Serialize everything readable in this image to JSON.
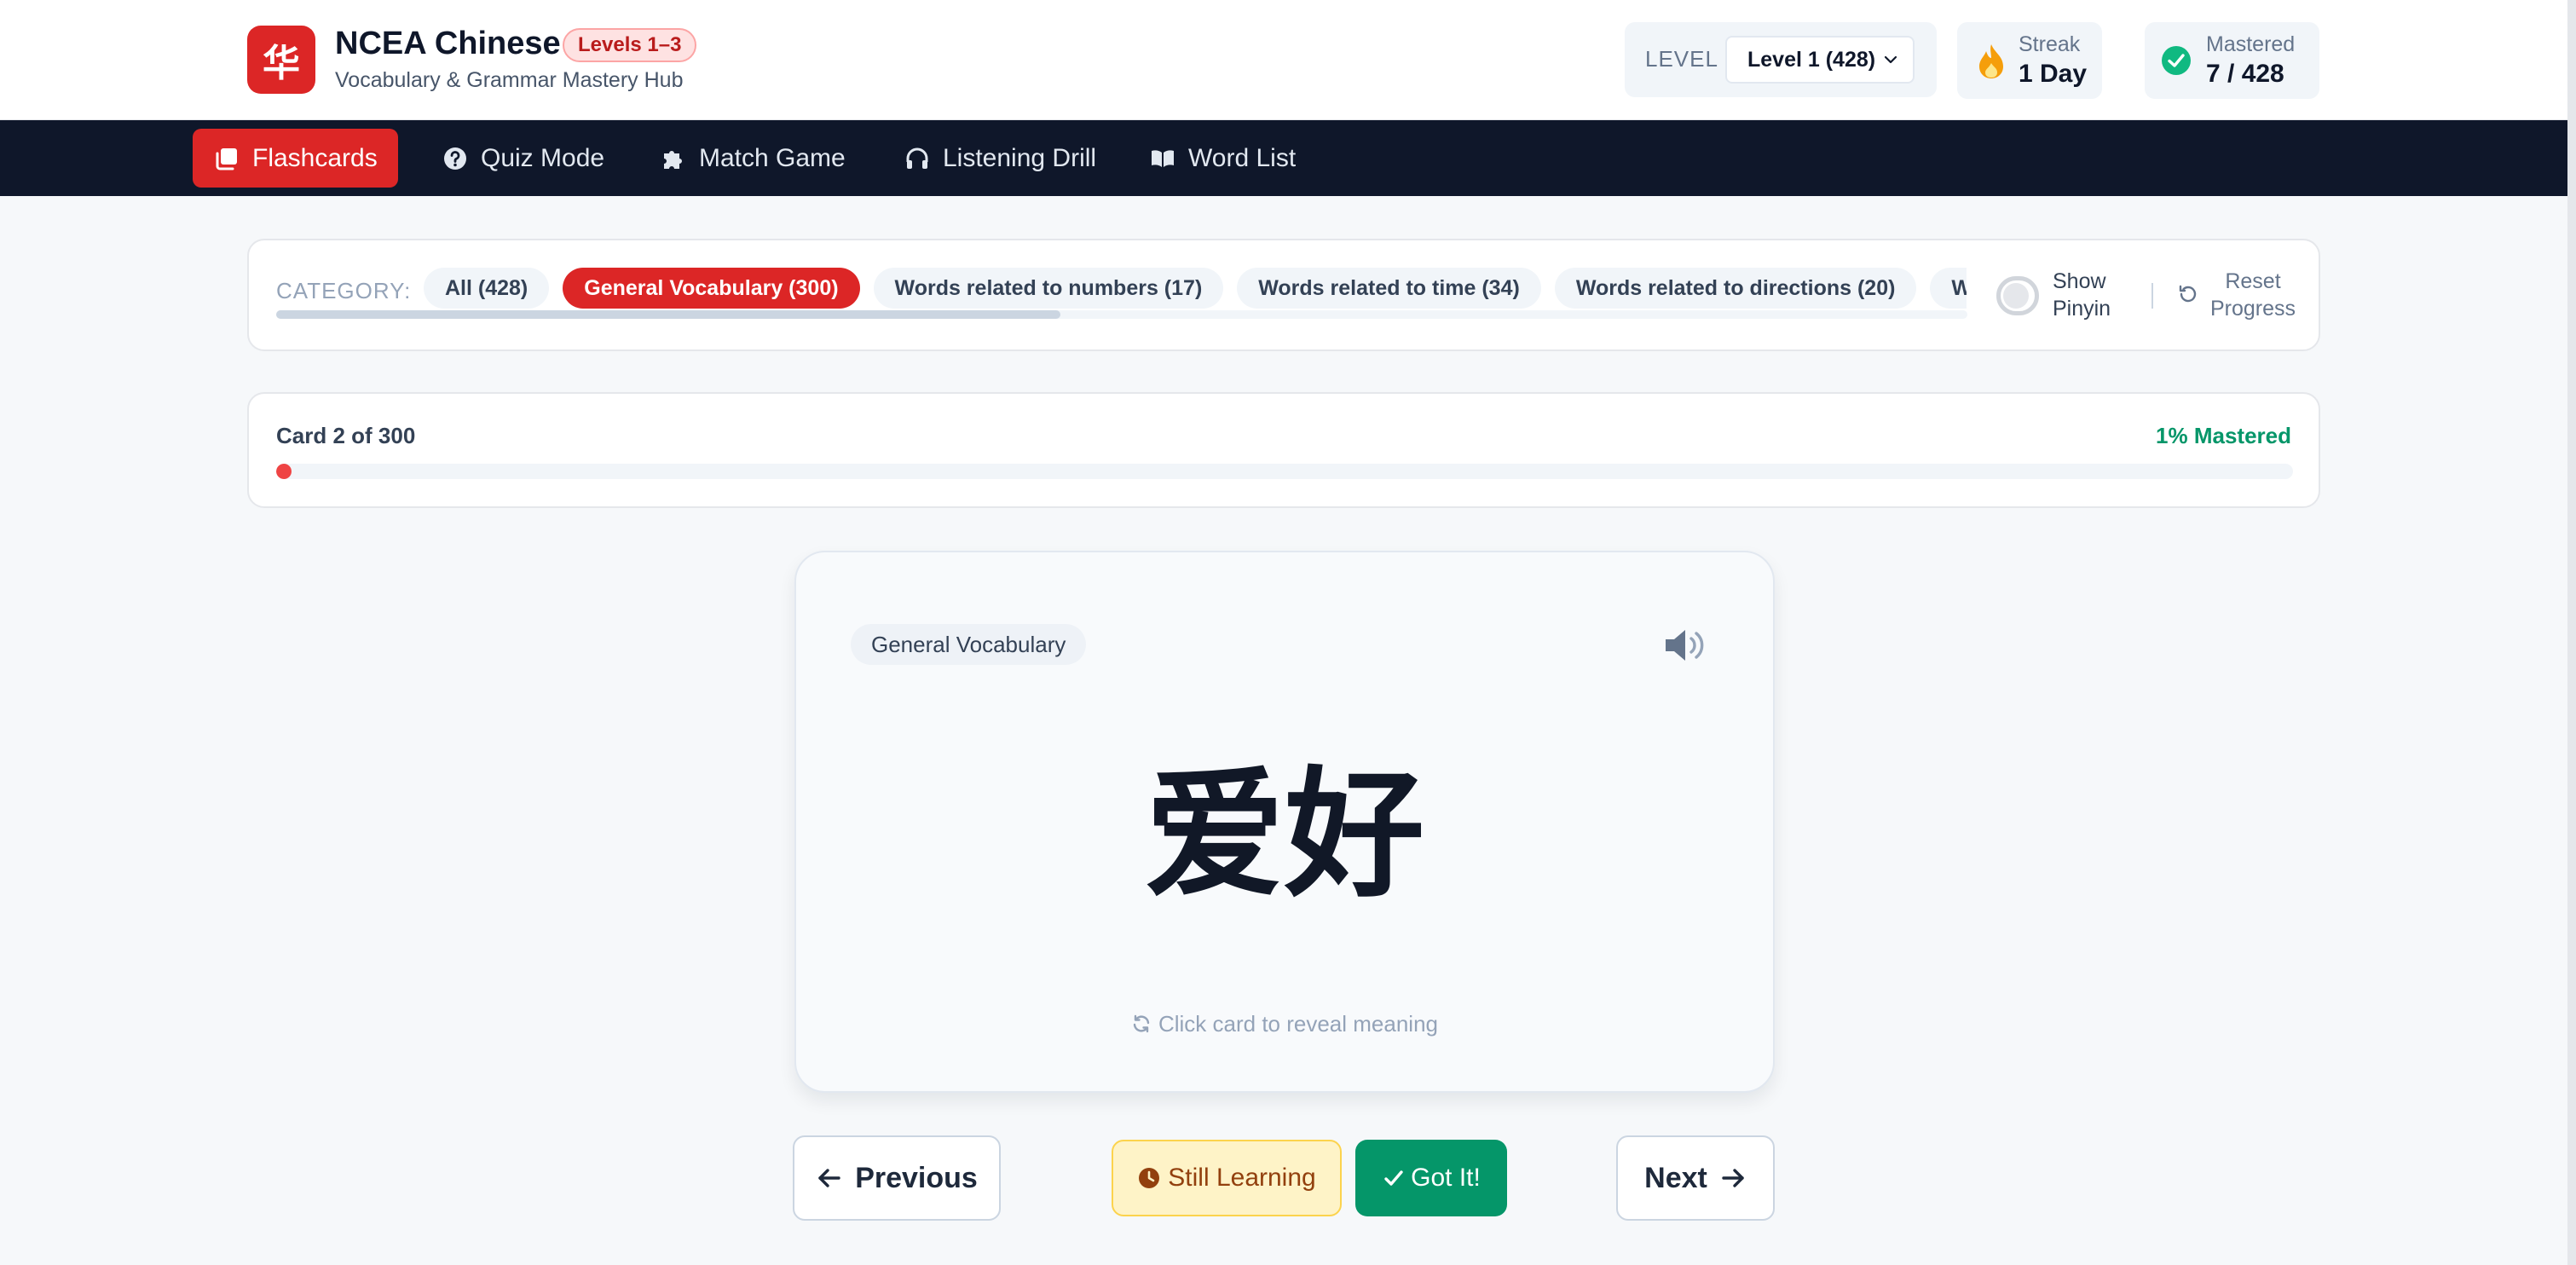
{
  "header": {
    "logo_glyph": "华",
    "title": "NCEA Chinese",
    "level_badge": "Levels 1–3",
    "subtitle": "Vocabulary & Grammar Mastery Hub",
    "level_label": "LEVEL",
    "level_selected": "Level 1 (428)",
    "streak_label": "Streak",
    "streak_value": "1 Day",
    "mastered_label": "Mastered",
    "mastered_value": "7 / 428"
  },
  "nav": {
    "items": [
      {
        "label": "Flashcards",
        "icon": "cards-icon",
        "active": true
      },
      {
        "label": "Quiz Mode",
        "icon": "question-circle-icon"
      },
      {
        "label": "Match Game",
        "icon": "puzzle-icon"
      },
      {
        "label": "Listening Drill",
        "icon": "headphones-icon"
      },
      {
        "label": "Word List",
        "icon": "book-open-icon"
      }
    ]
  },
  "categories": {
    "label": "CATEGORY:",
    "chips": [
      {
        "label": "All (428)"
      },
      {
        "label": "General Vocabulary (300)",
        "active": true
      },
      {
        "label": "Words related to numbers (17)"
      },
      {
        "label": "Words related to time (34)"
      },
      {
        "label": "Words related to directions (20)"
      },
      {
        "label": "Word"
      }
    ],
    "show_pinyin": "Show Pinyin",
    "reset": "Reset Progress"
  },
  "progress": {
    "card_count": "Card 2 of 300",
    "mastered_pct_text": "1% Mastered",
    "fill_fraction": 0.005
  },
  "card": {
    "category": "General Vocabulary",
    "hanzi": "爱好",
    "hint": "Click card to reveal meaning"
  },
  "actions": {
    "previous": "Previous",
    "still_learning": "Still Learning",
    "got_it": "Got It!",
    "next": "Next"
  },
  "colors": {
    "accent": "#dc2626",
    "nav_bg": "#0f172a",
    "success": "#059669",
    "warning_bg": "#fef3c7"
  }
}
